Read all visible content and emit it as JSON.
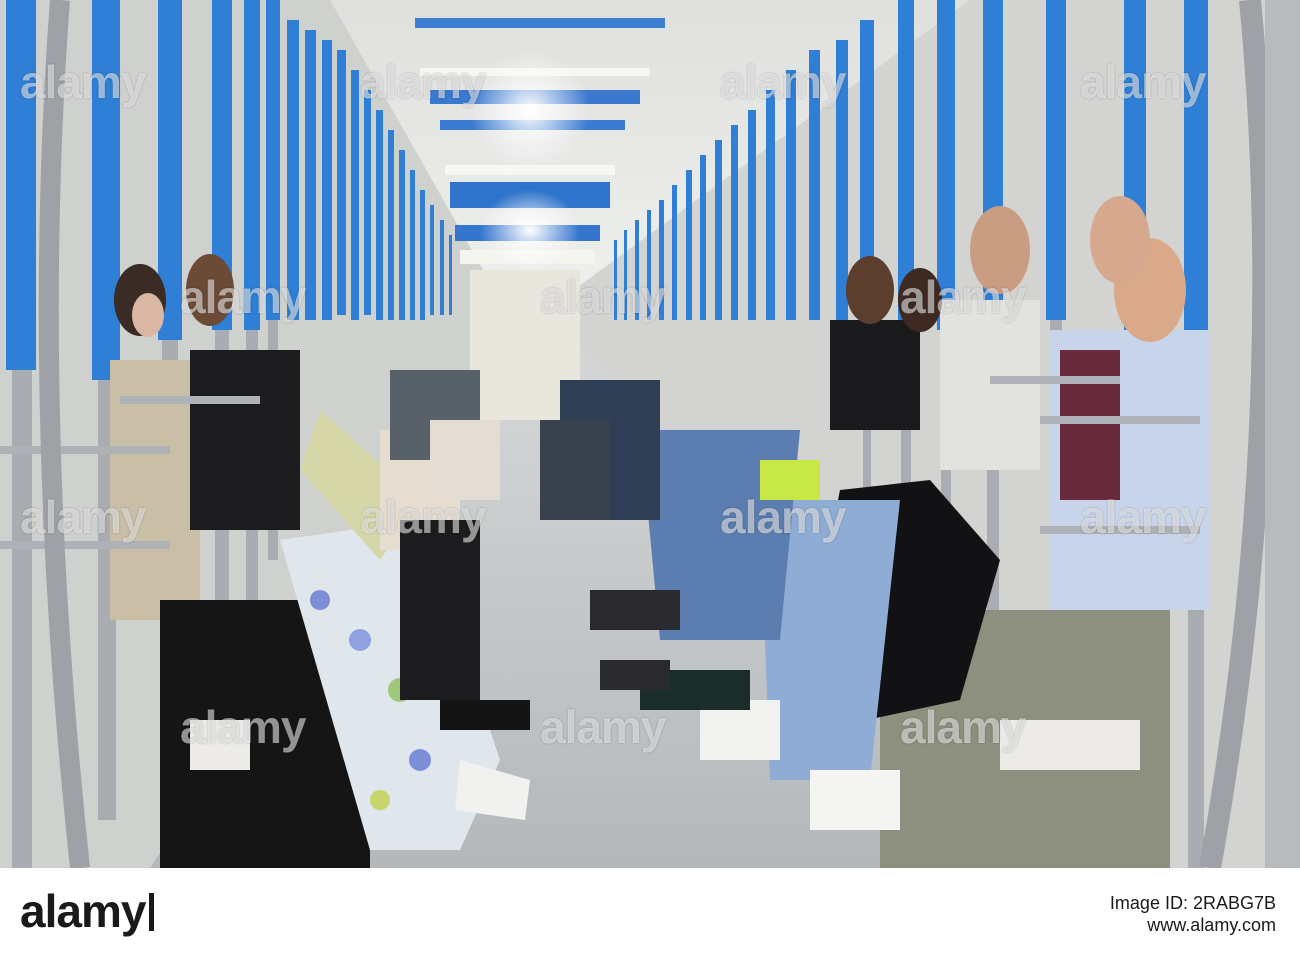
{
  "watermark": {
    "text": "alamy",
    "color": "#ffffff"
  },
  "footer": {
    "logo_text": "alamy",
    "image_id_line": "Image ID: 2RABG7B",
    "site_line": "www.alamy.com"
  },
  "scene": {
    "pole_color": "#2f7fd6",
    "steel_color": "#a9adb2",
    "floor_color": "#bfc3c6"
  }
}
